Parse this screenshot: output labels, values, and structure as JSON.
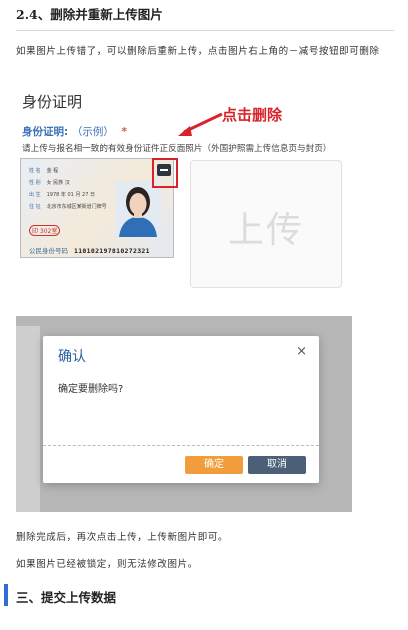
{
  "section_heading": "2.4、删除并重新上传图片",
  "intro": "如果图片上传错了，可以删除后重新上传，点击图片右上角的－减号按钮即可删除",
  "screenshot1": {
    "title": "身份证明",
    "label": "身份证明:",
    "label_example": "（示例）",
    "required_mark": "*",
    "hint": "请上传与报名相一致的有效身份证件正反面照片（外国护照需上传信息页与封页）",
    "annotation": "点击删除",
    "upload_placeholder": "上传",
    "id_card": {
      "name_label": "姓 名",
      "name": "金 程",
      "sex_label": "性 别",
      "sex": "女  民族 汉",
      "birth_label": "出 生",
      "birth": "1978 年 01 月 27 日",
      "addr_label": "住 址",
      "addr": "北京市东城区某街道门牌号",
      "stamp": "印 302室",
      "id_label": "公民身份号码",
      "id_number": "110102197810272321"
    }
  },
  "screenshot2": {
    "dialog_title": "确认",
    "close_symbol": "×",
    "message": "确定要删除吗?",
    "ok_label": "确定",
    "cancel_label": "取消"
  },
  "after_text_1": "删除完成后，再次点击上传，上传新图片即可。",
  "after_text_2": "如果图片已经被锁定，则无法修改图片。",
  "next_heading": "三、提交上传数据",
  "colors": {
    "annotation_red": "#d8232a",
    "heading_bar_blue": "#2d6fd3",
    "ok_button": "#f19d3b",
    "cancel_button": "#4b5f77",
    "dialog_title": "#2a5d9f"
  }
}
